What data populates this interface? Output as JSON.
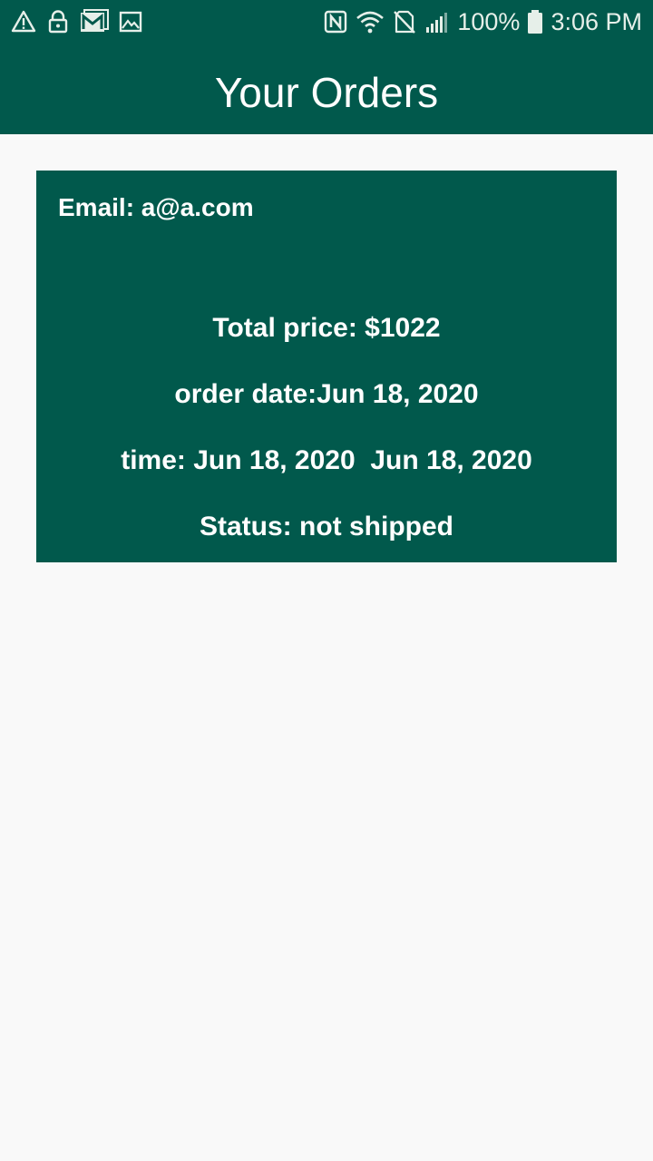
{
  "status_bar": {
    "left_icons": [
      "warning-icon",
      "lock-icon",
      "gmail-icon",
      "image-icon"
    ],
    "right_icons": [
      "nfc-icon",
      "wifi-icon",
      "no-sim-icon",
      "signal-icon",
      "battery-icon"
    ],
    "battery": "100%",
    "time": "3:06 PM"
  },
  "app_bar": {
    "title": "Your Orders"
  },
  "order": {
    "email": "Email: a@a.com",
    "total_price": "Total price: $1022",
    "order_date": "order date:Jun 18, 2020",
    "time": "time: Jun 18, 2020  Jun 18, 2020",
    "status": "Status: not shipped"
  },
  "colors": {
    "primary": "#01594c",
    "background": "#f9f9f9",
    "text_on_primary": "#ffffff"
  }
}
